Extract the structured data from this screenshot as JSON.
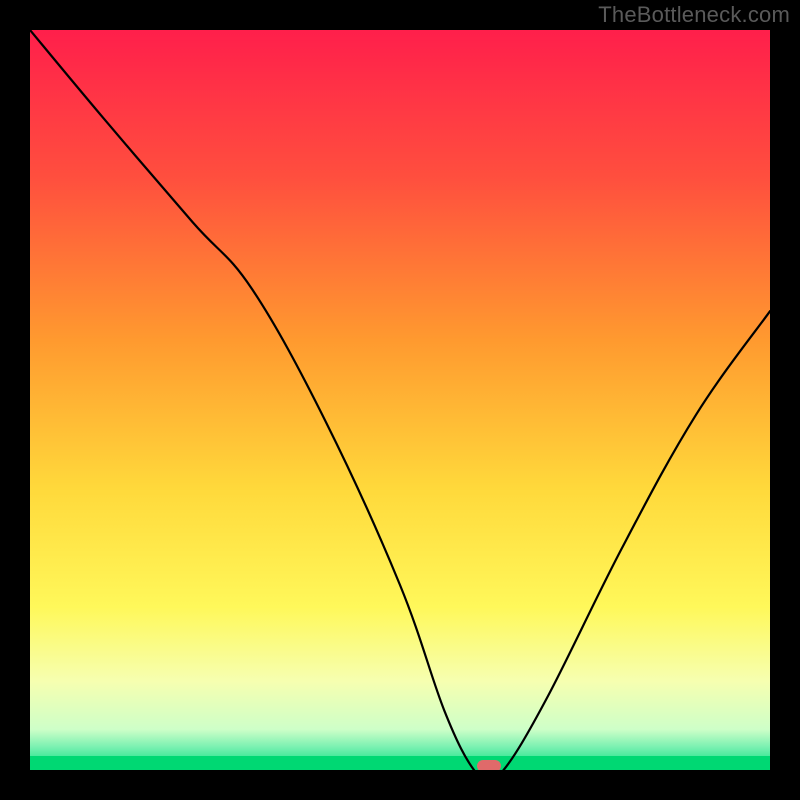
{
  "watermark": {
    "text": "TheBottleneck.com"
  },
  "chart_data": {
    "type": "line",
    "title": "",
    "xlabel": "",
    "ylabel": "",
    "xlim": [
      0,
      100
    ],
    "ylim": [
      0,
      100
    ],
    "grid": false,
    "legend": false,
    "series": [
      {
        "name": "bottleneck-curve",
        "x": [
          0,
          10,
          22,
          30,
          40,
          50,
          56,
          60,
          62,
          64,
          70,
          80,
          90,
          100
        ],
        "y": [
          100,
          88,
          74,
          65,
          47,
          25,
          8,
          0,
          0,
          0,
          10,
          30,
          48,
          62
        ]
      }
    ],
    "gradient_stops": [
      {
        "pos": 0.0,
        "color": "#ff1f4b"
      },
      {
        "pos": 0.2,
        "color": "#ff4f3e"
      },
      {
        "pos": 0.42,
        "color": "#ff9a2f"
      },
      {
        "pos": 0.62,
        "color": "#ffd93b"
      },
      {
        "pos": 0.78,
        "color": "#fff85a"
      },
      {
        "pos": 0.88,
        "color": "#f6ffb0"
      },
      {
        "pos": 0.945,
        "color": "#ceffc8"
      },
      {
        "pos": 0.97,
        "color": "#76f0b0"
      },
      {
        "pos": 1.0,
        "color": "#00e07a"
      }
    ],
    "green_band_color": "#00d873",
    "marker": {
      "x": 62,
      "y": 0.5,
      "color": "#e06a6a"
    },
    "curve_color": "#000000",
    "curve_width": 2.2
  }
}
